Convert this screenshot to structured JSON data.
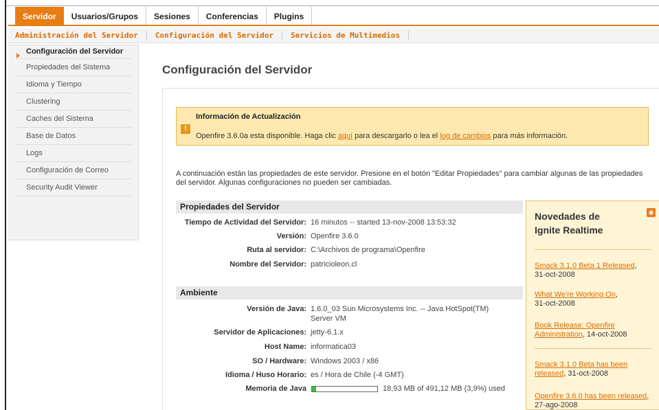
{
  "topnav": {
    "tabs": [
      "Servidor",
      "Usuarios/Grupos",
      "Sesiones",
      "Conferencias",
      "Plugins"
    ]
  },
  "subnav": {
    "tabs": [
      "Administración del Servidor",
      "Configuración del Servidor",
      "Servicios de Multimedios"
    ]
  },
  "sidebar": {
    "items": [
      "Configuración del Servidor",
      "Propiedades del Sistema",
      "Idioma y Tiempo",
      "Clustering",
      "Caches del Sistema",
      "Base de Datos",
      "Logs",
      "Configuración de Correo",
      "Security Audit Viewer"
    ]
  },
  "page": {
    "title": "Configuración del Servidor"
  },
  "update": {
    "title": "Información de Actualización",
    "msg_prefix": "Openfire 3.6.0a esta disponible. Haga clic ",
    "link1": "aquí",
    "msg_mid": " para descargarlo o lea el ",
    "link2": "log de cambios",
    "msg_suffix": " para más información."
  },
  "intro": "A continuación están las propiedades de este servidor. Presione en el botón \"Editar Propiedades\" para cambiar algunas de las propiedades del servidor. Algunas configuraciones no pueden ser cambiadas.",
  "props": {
    "section": "Propiedades del Servidor",
    "uptime_label": "Tiempo de Actividad del Servidor:",
    "uptime_value": "16 minutos -- started 13-nov-2008 13:53:32",
    "version_label": "Versión:",
    "version_value": "Openfire 3.6.0",
    "path_label": "Ruta al servidor:",
    "path_value": "C:\\Archivos de programa\\Openfire",
    "name_label": "Nombre del Servidor:",
    "name_value": "patricioleon.cl"
  },
  "env": {
    "section": "Ambiente",
    "java_label": "Versión de Java:",
    "java_value_1": "1.6.0_03 Sun Microsystems Inc. -- Java HotSpot(TM)",
    "java_value_2": "Server VM",
    "appserver_label": "Servidor de Aplicaciones:",
    "appserver_value": "jetty-6.1.x",
    "host_label": "Host Name:",
    "host_value": "informatica03",
    "os_label": "SO / Hardware:",
    "os_value": "Windows 2003 / x86",
    "locale_label": "Idioma / Huso Horario:",
    "locale_value": "es / Hora de Chile (-4 GMT)",
    "memory_label": "Memoria de Java",
    "memory_value": "18,93 MB of 491,12 MB (3,9%) used",
    "memory_fraction": 0.039
  },
  "news": {
    "title": "Novedades de Ignite Realtime",
    "items": [
      {
        "link": "Smack 3.1.0 Beta 1 Released",
        "date": "31-oct-2008"
      },
      {
        "link": "What We're Working On",
        "date": "31-oct-2008"
      },
      {
        "link": "Book Release: Openfire Administration",
        "date": "14-oct-2008"
      },
      {
        "link": "Smack 3.1.0 Beta has been released",
        "date": "31-oct-2008"
      },
      {
        "link": "Openfire 3.6.0 has been released",
        "date": "27-ago-2008"
      }
    ]
  },
  "colors": {
    "accent": "#e87d13",
    "link": "#d96b00",
    "update_bg": "#fde9b0",
    "news_bg": "#fff5d6",
    "memory_fill": "#3dbd3d"
  }
}
